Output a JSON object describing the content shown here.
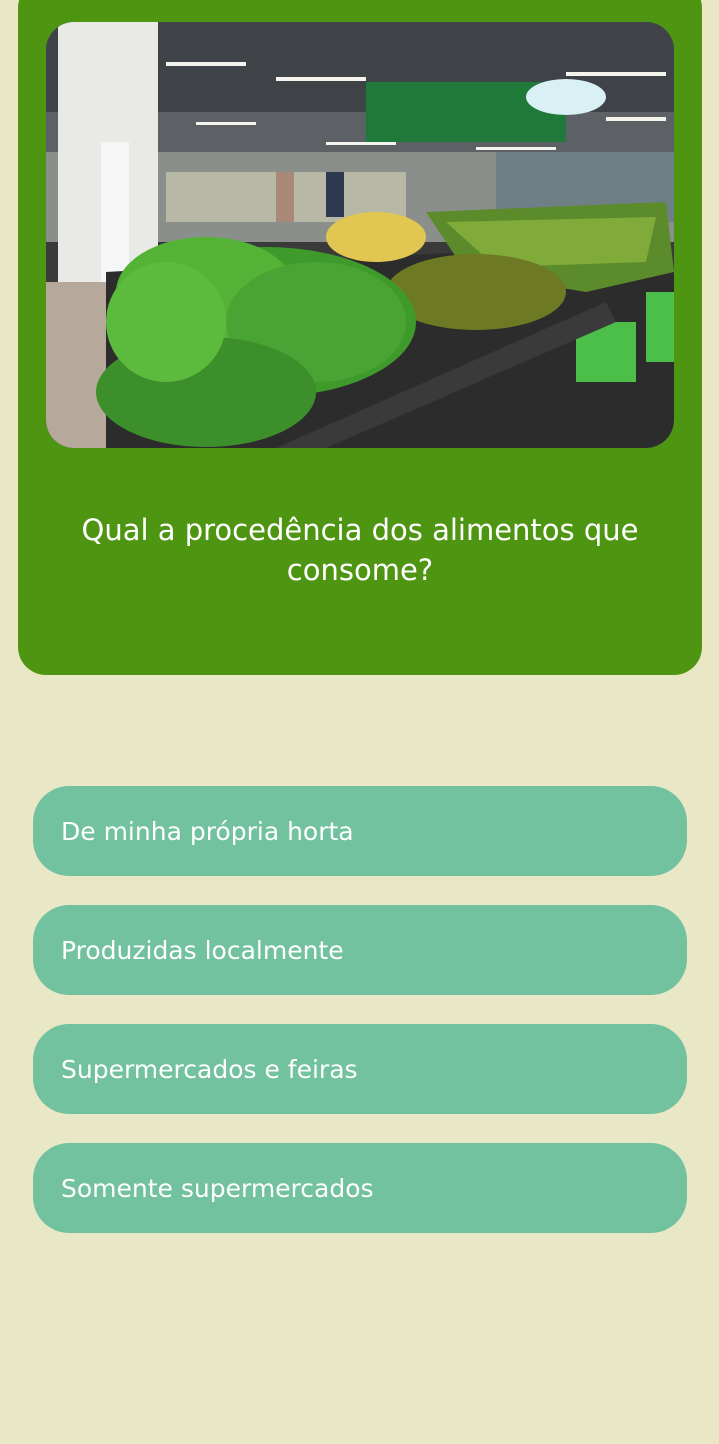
{
  "question": {
    "text": "Qual a procedência dos alimentos que consome?",
    "image_alt": "supermarket-produce-photo"
  },
  "options": [
    {
      "label": "De minha própria horta"
    },
    {
      "label": "Produzidas localmente"
    },
    {
      "label": "Supermercados e feiras"
    },
    {
      "label": "Somente supermercados"
    }
  ],
  "colors": {
    "background": "#e8e7c6",
    "card": "#4e9612",
    "option": "#72c19f",
    "text": "#ffffff"
  }
}
